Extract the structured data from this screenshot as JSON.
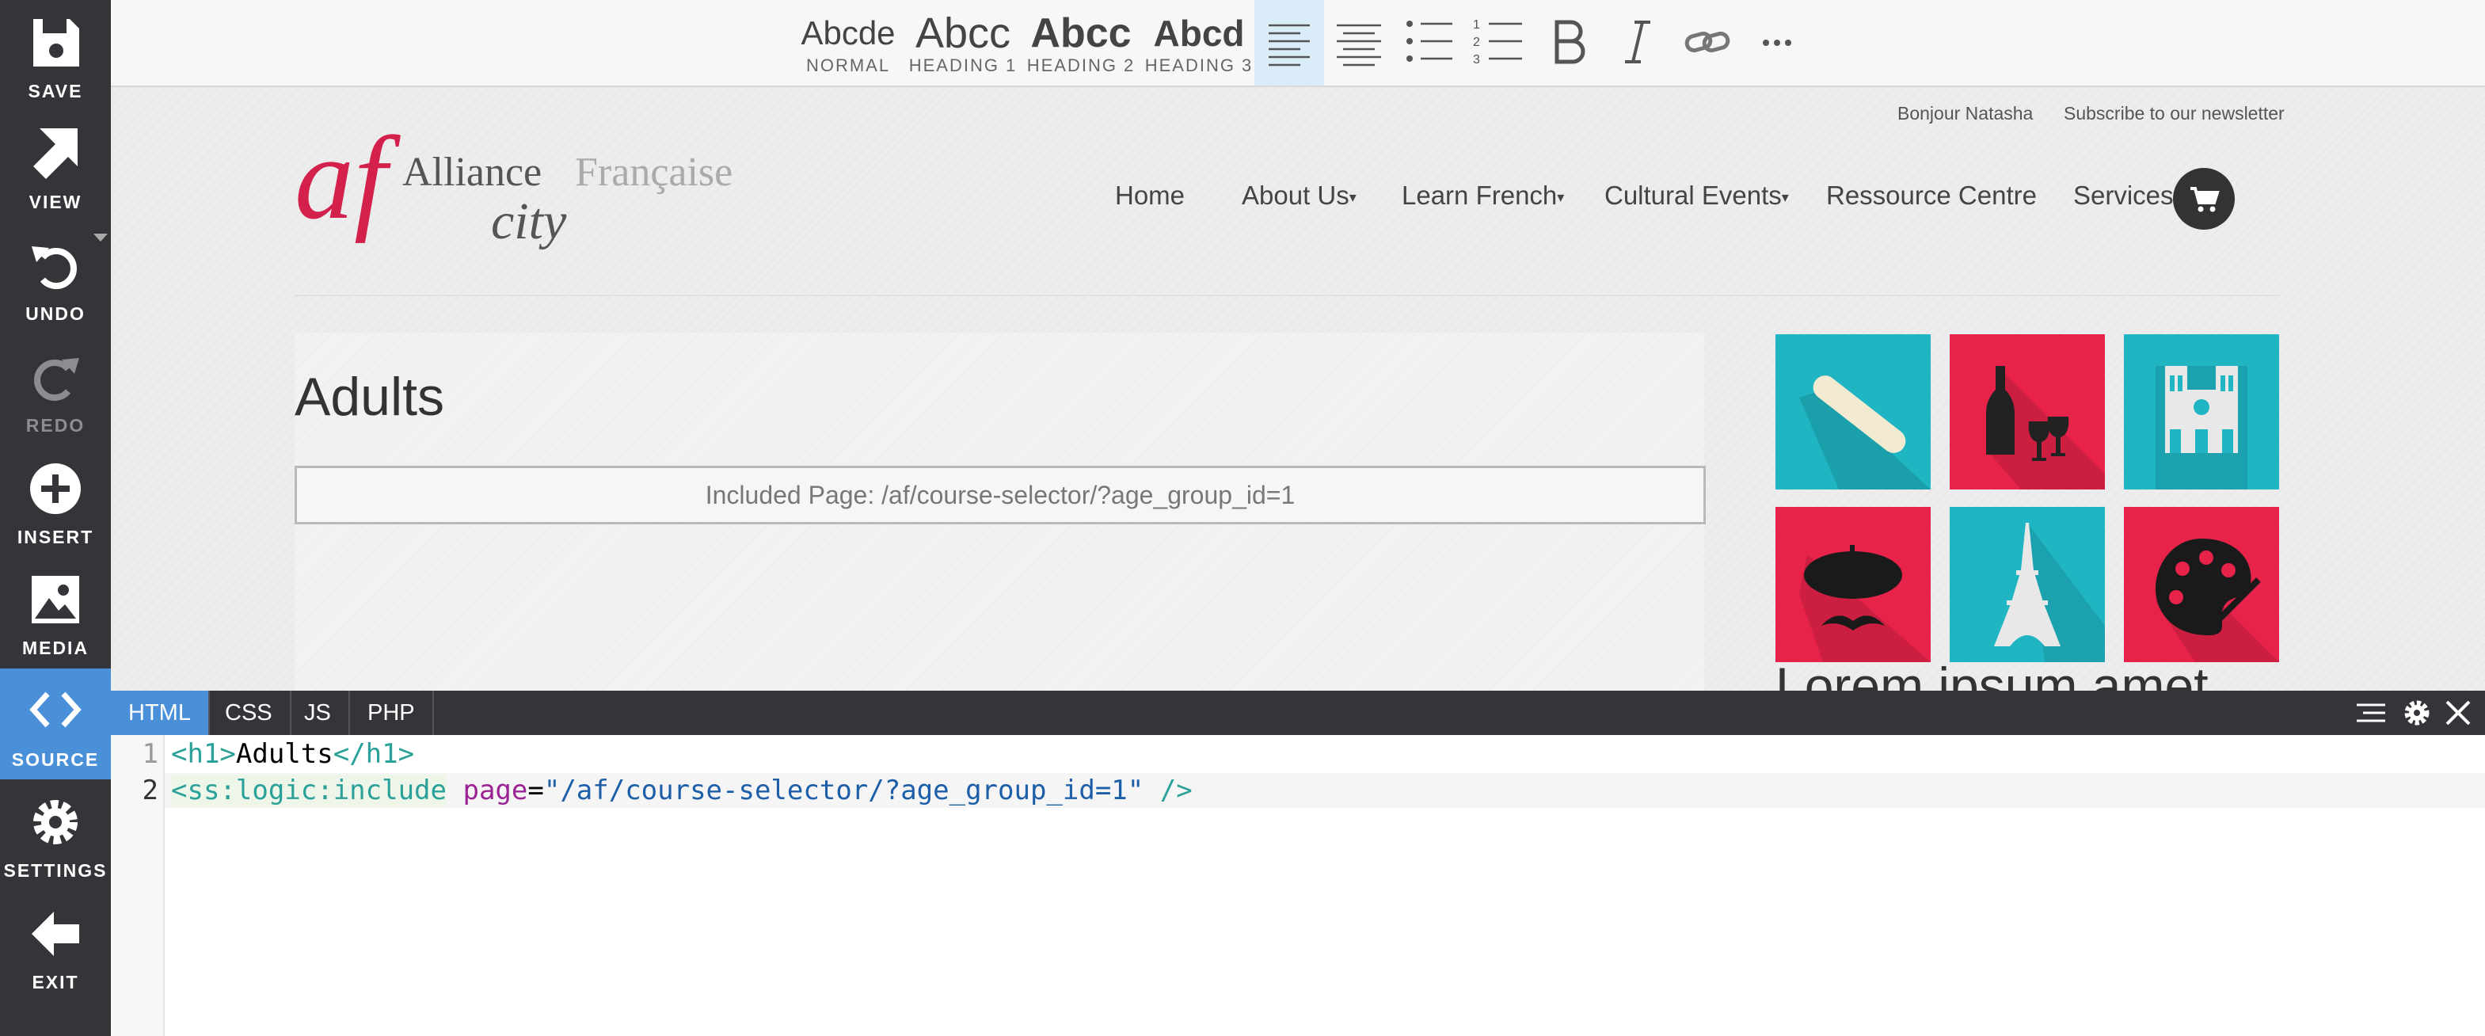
{
  "sidebar": {
    "items": [
      {
        "label": "SAVE",
        "icon": "save-icon"
      },
      {
        "label": "VIEW",
        "icon": "view-arrow-icon"
      },
      {
        "label": "UNDO",
        "icon": "undo-icon"
      },
      {
        "label": "REDO",
        "icon": "redo-icon",
        "disabled": true
      },
      {
        "label": "INSERT",
        "icon": "plus-circle-icon"
      },
      {
        "label": "MEDIA",
        "icon": "image-icon"
      },
      {
        "label": "SOURCE",
        "icon": "code-icon",
        "active": true
      },
      {
        "label": "SETTINGS",
        "icon": "gear-icon"
      },
      {
        "label": "EXIT",
        "icon": "arrow-left-icon"
      }
    ]
  },
  "toolbar": {
    "formats": [
      {
        "sample": "Abcde",
        "label": "NORMAL"
      },
      {
        "sample": "Abcc",
        "label": "HEADING 1"
      },
      {
        "sample": "Abcc",
        "label": "HEADING 2"
      },
      {
        "sample": "Abcd",
        "label": "HEADING 3"
      }
    ],
    "buttons": [
      "align-left-icon",
      "align-center-icon",
      "bullet-list-icon",
      "numbered-list-icon",
      "bold-icon",
      "italic-icon",
      "link-icon",
      "more-icon"
    ]
  },
  "site": {
    "top_links": [
      "Bonjour Natasha",
      "Subscribe to our newsletter"
    ],
    "logo": {
      "mark": "af",
      "line1a": "Alliance",
      "line1b": "Française",
      "line2": "city"
    },
    "nav": [
      {
        "label": "Home"
      },
      {
        "label": "About Us",
        "dropdown": true
      },
      {
        "label": "Learn French",
        "dropdown": true
      },
      {
        "label": "Cultural Events",
        "dropdown": true
      },
      {
        "label": "Ressource Centre"
      },
      {
        "label": "Services"
      }
    ],
    "heading": "Adults",
    "included_page": "Included Page: /af/course-selector/?age_group_id=1",
    "sidebar_heading": "Lorem ipsum amet",
    "tiles": [
      "baguette",
      "wine",
      "notre-dame",
      "beret-moustache",
      "eiffel-tower",
      "palette"
    ],
    "colors": {
      "teal": "#1fb5c2",
      "red": "#e8234a"
    }
  },
  "source": {
    "tabs": [
      "HTML",
      "CSS",
      "JS",
      "PHP"
    ],
    "active_tab": "HTML",
    "lines": [
      {
        "num": "1",
        "open": "<h1>",
        "text": "Adults",
        "close": "</h1>"
      },
      {
        "num": "2",
        "tag": "<ss:logic:include",
        "attr": "page",
        "eq": "=",
        "val": "\"/af/course-selector/?age_group_id=1\"",
        "end": " />"
      }
    ]
  }
}
